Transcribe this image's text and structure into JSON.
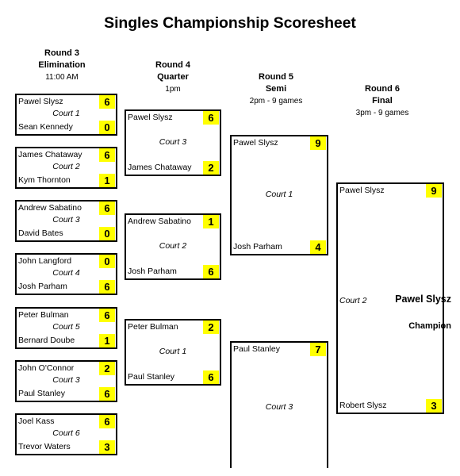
{
  "title": "Singles Championship Scoresheet",
  "colors": {
    "score_highlight": "#ffff00",
    "border": "#000000",
    "text": "#000000",
    "background": "#ffffff"
  },
  "rounds": [
    {
      "number": "Round 3",
      "stage": "Elimination",
      "time": "11:00 AM"
    },
    {
      "number": "Round 4",
      "stage": "Quarter",
      "time": "1pm"
    },
    {
      "number": "Round 5",
      "stage": "Semi",
      "time": "2pm - 9 games"
    },
    {
      "number": "Round 6",
      "stage": "Final",
      "time": "3pm - 9 games"
    }
  ],
  "round3": {
    "matches": [
      {
        "court": "Court 1",
        "top": {
          "name": "Pawel Slysz",
          "score": "6"
        },
        "bottom": {
          "name": "Sean Kennedy",
          "score": "0"
        }
      },
      {
        "court": "Court 2",
        "top": {
          "name": "James Chataway",
          "score": "6"
        },
        "bottom": {
          "name": "Kym Thornton",
          "score": "1"
        }
      },
      {
        "court": "Court 3",
        "top": {
          "name": "Andrew Sabatino",
          "score": "6"
        },
        "bottom": {
          "name": "David Bates",
          "score": "0"
        }
      },
      {
        "court": "Court 4",
        "top": {
          "name": "John Langford",
          "score": "0"
        },
        "bottom": {
          "name": "Josh Parham",
          "score": "6"
        }
      },
      {
        "court": "Court 5",
        "top": {
          "name": "Peter Bulman",
          "score": "6"
        },
        "bottom": {
          "name": "Bernard Doube",
          "score": "1"
        }
      },
      {
        "court": "Court 3",
        "top": {
          "name": "John O'Connor",
          "score": "2"
        },
        "bottom": {
          "name": "Paul Stanley",
          "score": "6"
        }
      },
      {
        "court": "Court 6",
        "top": {
          "name": "Joel Kass",
          "score": "6"
        },
        "bottom": {
          "name": "Trevor Waters",
          "score": "3"
        }
      }
    ]
  },
  "round4": {
    "matches": [
      {
        "court": "Court 3",
        "top": {
          "name": "Pawel Slysz",
          "score": "6"
        },
        "bottom": {
          "name": "James Chataway",
          "score": "2"
        }
      },
      {
        "court": "Court 2",
        "top": {
          "name": "Andrew Sabatino",
          "score": "1"
        },
        "bottom": {
          "name": "Josh Parham",
          "score": "6"
        }
      },
      {
        "court": "Court 1",
        "top": {
          "name": "Peter Bulman",
          "score": "2"
        },
        "bottom": {
          "name": "Paul Stanley",
          "score": "6"
        }
      }
    ]
  },
  "round5": {
    "matches": [
      {
        "court": "Court 1",
        "top": {
          "name": "Pawel Slysz",
          "score": "9"
        },
        "bottom": {
          "name": "Josh Parham",
          "score": "4"
        }
      },
      {
        "court": "Court 3",
        "top": {
          "name": "Paul Stanley",
          "score": "7"
        },
        "bottom": {
          "name": "",
          "score": ""
        }
      }
    ]
  },
  "round6": {
    "matches": [
      {
        "court": "Court 2",
        "top": {
          "name": "Pawel Slysz",
          "score": "9"
        },
        "bottom": {
          "name": "Robert Slysz",
          "score": "3"
        }
      }
    ],
    "champion": {
      "name": "Pawel Slysz",
      "label": "Champion"
    }
  }
}
